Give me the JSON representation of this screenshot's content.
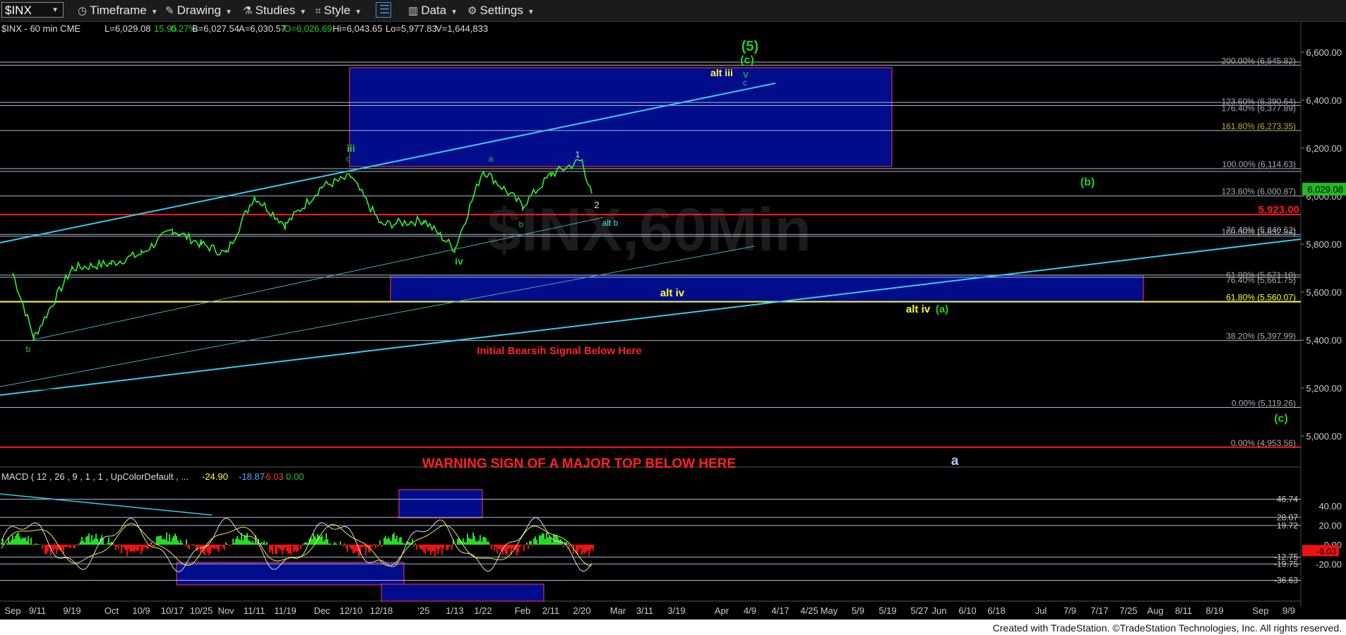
{
  "toolbar": {
    "symbol": "$INX",
    "items": [
      "Timeframe",
      "Drawing",
      "Studies",
      "Style",
      "Data",
      "Settings"
    ]
  },
  "header": {
    "symbol_line": "$INX - 60 min  CME",
    "last": "L=6,029.08",
    "change": "15.95",
    "pct": "0.27%",
    "bid": "B=6,027.54",
    "ask": "A=6,030.57",
    "open": "O=6,026.69",
    "high": "Hi=6,043.65",
    "low": "Lo=5,977.83",
    "volume": "V=1,644,833"
  },
  "watermark": "$INX,60Min",
  "chart_data": {
    "type": "line",
    "title": "$INX - 60 min",
    "price_axis": {
      "ticks": [
        "6,600.00",
        "6,400.00",
        "6,200.00",
        "6,000.00",
        "5,800.00",
        "5,600.00",
        "5,400.00",
        "5,200.00",
        "5,000.00"
      ],
      "ylim": [
        4880,
        6680
      ],
      "last_price_tag": "6,029.08"
    },
    "time_axis": [
      "Sep",
      "9/11",
      "9/19",
      "Oct",
      "10/9",
      "10/17",
      "10/25",
      "Nov",
      "11/11",
      "11/19",
      "Dec",
      "12/10",
      "12/18",
      "'25",
      "1/13",
      "1/22",
      "Feb",
      "2/11",
      "2/20",
      "Mar",
      "3/11",
      "3/19",
      "Apr",
      "4/9",
      "4/17",
      "4/25",
      "May",
      "5/9",
      "5/19",
      "5/27",
      "Jun",
      "6/10",
      "6/18",
      "Jul",
      "7/9",
      "7/17",
      "7/25",
      "Aug",
      "8/11",
      "8/19",
      "Sep",
      "9/9"
    ],
    "price_series": {
      "name": "$INX",
      "points": [
        [
          "Sep",
          5680
        ],
        [
          "9/11",
          5410
        ],
        [
          "9/19",
          5700
        ],
        [
          "Oct",
          5720
        ],
        [
          "10/9",
          5760
        ],
        [
          "10/17",
          5860
        ],
        [
          "10/25",
          5800
        ],
        [
          "Nov",
          5760
        ],
        [
          "11/11",
          6000
        ],
        [
          "11/19",
          5880
        ],
        [
          "Dec",
          6040
        ],
        [
          "12/10",
          6080
        ],
        [
          "12/18",
          5880
        ],
        [
          "'25",
          5900
        ],
        [
          "1/13",
          5780
        ],
        [
          "1/22",
          6110
        ],
        [
          "Feb",
          5960
        ],
        [
          "2/11",
          6090
        ],
        [
          "2/20",
          6150
        ],
        [
          "2/20",
          6000
        ]
      ]
    },
    "fib_levels": [
      {
        "label": "200.00% (6,545.82)",
        "value": 6545.82
      },
      {
        "label": "123.60% (6,390.64)",
        "value": 6390.64
      },
      {
        "label": "176.40% (6,377.89)",
        "value": 6377.89
      },
      {
        "label": "161.80% (6,273.35)",
        "value": 6273.35
      },
      {
        "label": "100.00% (6,114.63)",
        "value": 6114.63
      },
      {
        "label": "123.60% (6,000.87)",
        "value": 6000.87
      },
      {
        "label": "76.40% (5,840.62)",
        "value": 5840.62
      },
      {
        "label": "100.00% (5,832.84)",
        "value": 5832.84
      },
      {
        "label": "61.80% (5,671.10)",
        "value": 5671.1
      },
      {
        "label": "76.40% (5,661.75)",
        "value": 5661.75
      },
      {
        "label": "61.80% (5,560.07)",
        "value": 5560.07
      },
      {
        "label": "38.20% (5,397.99)",
        "value": 5397.99
      },
      {
        "label": "0.00% (5,119.26)",
        "value": 5119.26
      },
      {
        "label": "0.00% (4,953.56)",
        "value": 4953.56
      }
    ],
    "key_level": {
      "label": "5,923.00",
      "value": 5923.0
    },
    "annotations": [
      {
        "text": "(5)",
        "color": "#22cc22"
      },
      {
        "text": "(c)",
        "color": "#22cc22"
      },
      {
        "text": "v",
        "color": "#22cc22"
      },
      {
        "text": "c",
        "color": "#44aaff"
      },
      {
        "text": "alt iii",
        "color": "#ffff33"
      },
      {
        "text": "iii",
        "color": "#22cc22"
      },
      {
        "text": "c",
        "color": "#22cc22"
      },
      {
        "text": "a",
        "color": "#22cc22"
      },
      {
        "text": "1",
        "color": "#dddddd"
      },
      {
        "text": "2",
        "color": "#dddddd"
      },
      {
        "text": "b",
        "color": "#22cc22"
      },
      {
        "text": "alt b",
        "color": "#44ddff"
      },
      {
        "text": "iv",
        "color": "#22cc22"
      },
      {
        "text": "b",
        "color": "#22cc22"
      },
      {
        "text": "(b)",
        "color": "#22cc22"
      },
      {
        "text": "alt iv",
        "color": "#ffff33"
      },
      {
        "text": "alt iv",
        "color": "#ffff33"
      },
      {
        "text": "(a)",
        "color": "#22cc22"
      },
      {
        "text": "(c)",
        "color": "#22cc22"
      },
      {
        "text": "a",
        "color": "#aaccff"
      },
      {
        "text": "Initial Bearsih Signal Below Here",
        "color": "#ff2222"
      },
      {
        "text": "WARNING SIGN OF A MAJOR TOP BELOW HERE",
        "color": "#ff2222"
      }
    ],
    "macd": {
      "label": "MACD ( 12 , 26 , 9 , 1 , 1 , UpColorDefault , ...",
      "values": [
        "-24.90",
        "-18.87",
        "-6.03",
        "0.00"
      ],
      "axis_ticks": [
        "40.00",
        "20.00",
        "0.00",
        "-20.00"
      ],
      "level_tags": [
        "46.74",
        "28.07",
        "19.72",
        "-12.75",
        "-19.75",
        "-36.63"
      ],
      "last_tag": "-6.03"
    }
  },
  "footer": "Created with TradeStation. ©TradeStation Technologies, Inc. All rights reserved.",
  "colors": {
    "price": "#33ee33",
    "trendline": "#33ccee",
    "box": "#000c8a",
    "red_level": "#ff1a1a",
    "yellow_level": "#ffff33"
  }
}
